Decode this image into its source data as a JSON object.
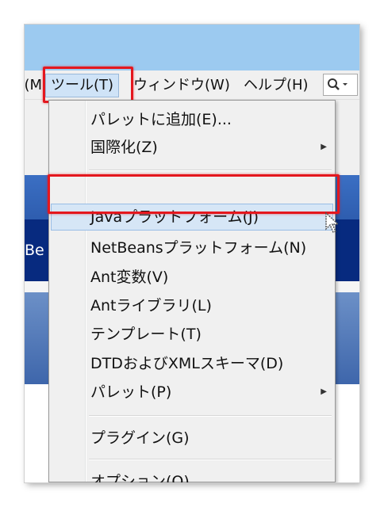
{
  "menubar": {
    "cut_item": "M)",
    "tools": "ツール(T)",
    "window": "ウィンドウ(W)",
    "help": "ヘルプ(H)"
  },
  "background": {
    "cut_text": "Be"
  },
  "menu": {
    "items": [
      {
        "label": "パレットに追加(E)..."
      },
      {
        "label": "国際化(Z)",
        "submenu": true
      },
      {
        "label": "Javaプラットフォーム(J)",
        "active": true
      },
      {
        "label": "NetBeansプラットフォーム(N)"
      },
      {
        "label": "Ant変数(V)"
      },
      {
        "label": "Antライブラリ(L)"
      },
      {
        "label": "テンプレート(T)"
      },
      {
        "label": "DTDおよびXMLスキーマ(D)"
      },
      {
        "label": "パレット(P)",
        "submenu": true
      },
      {
        "label": "プラグイン(G)"
      },
      {
        "label": "オプション(O)"
      }
    ]
  },
  "colors": {
    "highlight": "#e4171e",
    "hover": "#d6e6f6",
    "titlebar": "#9ccaf0"
  }
}
